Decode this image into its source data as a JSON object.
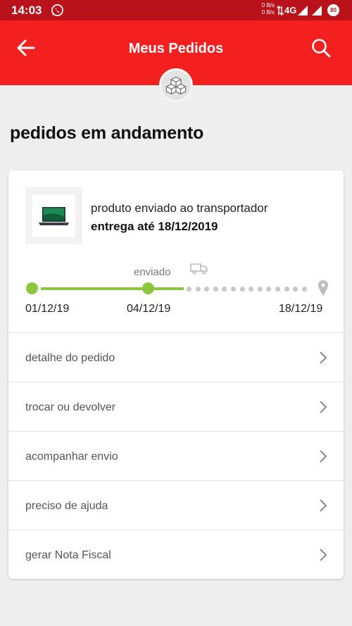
{
  "status_bar": {
    "time": "14:03",
    "net_up": "0 B/s",
    "net_down": "0 B/s",
    "network": "4G",
    "battery": "80",
    "icons": [
      "whatsapp-icon",
      "data-arrows-icon",
      "signal-icon",
      "battery-icon"
    ]
  },
  "header": {
    "title": "Meus Pedidos",
    "back_icon": "arrow-left-icon",
    "search_icon": "search-icon",
    "badge_icon": "boxes-icon"
  },
  "section": {
    "title": "pedidos em andamento"
  },
  "order": {
    "status": "produto enviado ao transportador",
    "delivery": "entrega até 18/12/2019",
    "timeline": {
      "stage_label": "enviado",
      "dates": [
        "01/12/19",
        "04/12/19",
        "18/12/19"
      ],
      "progress_fraction": 0.5
    }
  },
  "menu": [
    {
      "label": "detalhe do pedido"
    },
    {
      "label": "trocar ou devolver"
    },
    {
      "label": "acompanhar envio"
    },
    {
      "label": "preciso de ajuda"
    },
    {
      "label": "gerar Nota Fiscal"
    }
  ],
  "colors": {
    "status_bar": "#b9121b",
    "app_bar": "#f4201f",
    "progress": "#8cc63f",
    "pending": "#c8c8c8"
  }
}
